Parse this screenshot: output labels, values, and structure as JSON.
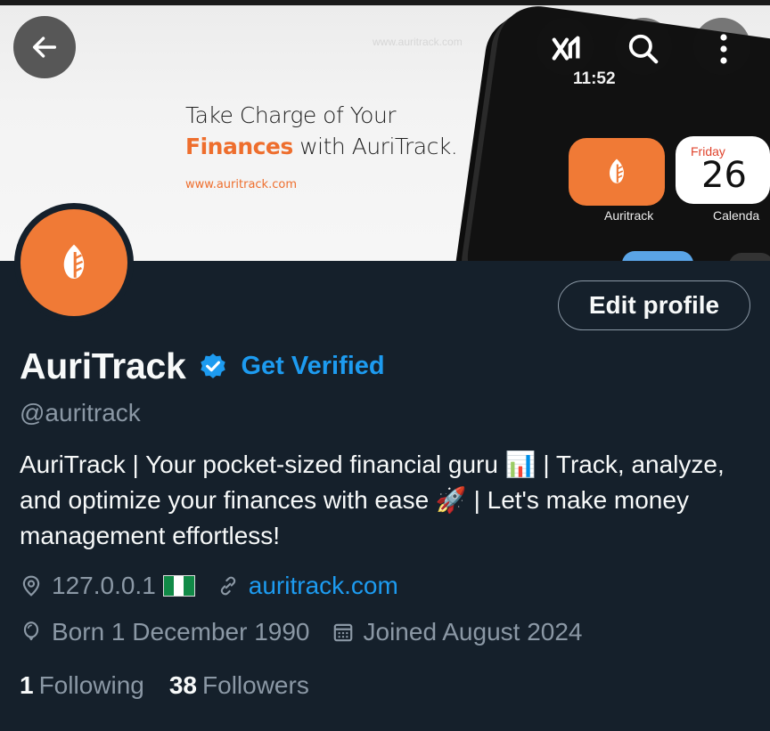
{
  "banner": {
    "headline_line1": "Take Charge of Your",
    "headline_accent": "Finances",
    "headline_rest": " with AuriTrack.",
    "url": "www.auritrack.com",
    "watermark": "www.auritrack.com",
    "phone_time": "11:52",
    "app1_label": "Auritrack",
    "app2_day": "Friday",
    "app2_date": "26",
    "app2_label": "Calenda"
  },
  "nav": {
    "back_icon": "arrow-left-icon",
    "grok_icon": "grok-icon",
    "search_icon": "search-icon",
    "more_icon": "more-vertical-icon"
  },
  "profile": {
    "edit_label": "Edit profile",
    "name": "AuriTrack",
    "get_verified": "Get Verified",
    "handle": "@auritrack",
    "bio": "AuriTrack | Your pocket-sized financial guru 📊 | Track, analyze, and optimize your finances with ease 🚀 | Let's make money management effortless!",
    "location": "127.0.0.1",
    "website": "auritrack.com",
    "born": "Born 1 December 1990",
    "joined": "Joined August 2024",
    "following_count": "1",
    "following_label": "Following",
    "followers_count": "38",
    "followers_label": "Followers"
  },
  "colors": {
    "background": "#15202b",
    "accent_blue": "#1d9bf0",
    "brand_orange": "#f07a36",
    "muted": "#8b98a5"
  }
}
